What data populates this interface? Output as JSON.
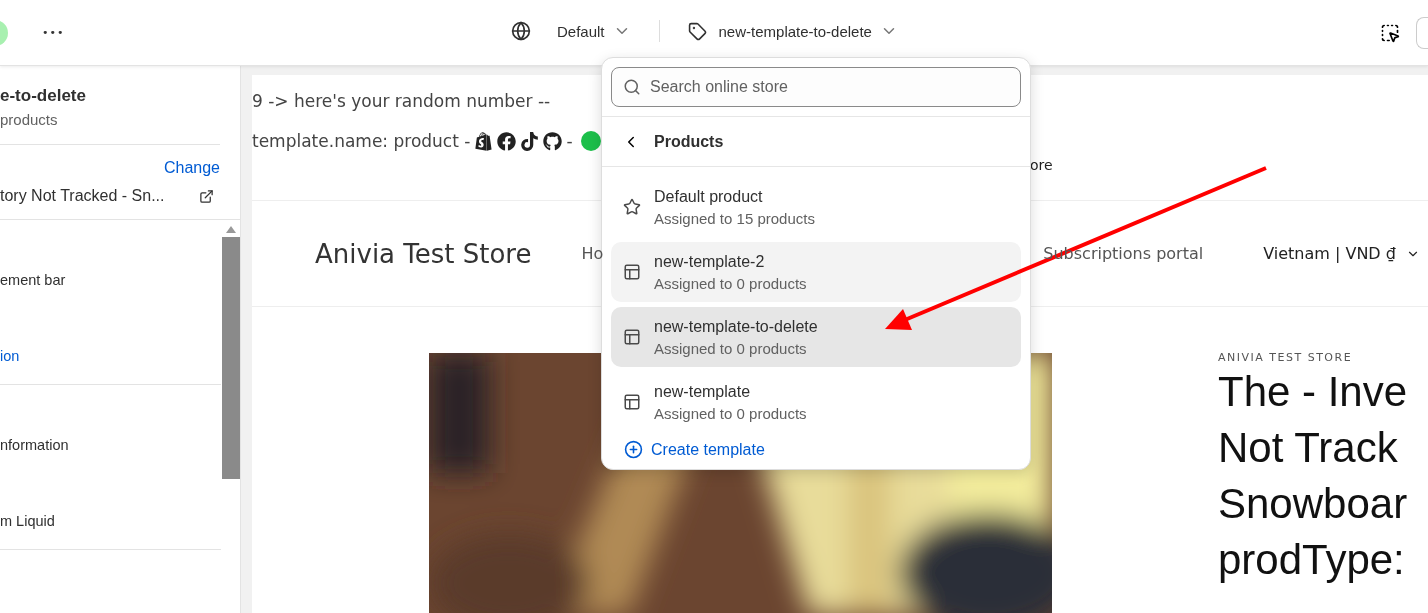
{
  "topbar": {
    "more": "•••",
    "theme": "Default",
    "template": "new-template-to-delete"
  },
  "sidebar": {
    "title": "e-to-delete",
    "subtitle": "products",
    "change_link": "Change",
    "product": "tory Not Tracked - Sn...",
    "sections": [
      {
        "items": [
          {
            "kind": "label",
            "text": "ement bar"
          },
          {
            "kind": "link",
            "text": "ion"
          }
        ]
      },
      {
        "items": [
          {
            "kind": "label",
            "text": "nformation"
          },
          {
            "kind": "label",
            "text": "m Liquid"
          }
        ]
      }
    ]
  },
  "preview": {
    "line_1": "9 -> here's your random number --",
    "line_2": "template.name: product -",
    "line_2_end": "-",
    "announcement": "ore",
    "store_name": "Anivia Test Store",
    "nav": [
      "Ho",
      "Subscriptions portal"
    ],
    "locale": "Vietnam | VND ₫",
    "vendor": "ANIVIA TEST STORE",
    "title_lines": [
      "The - Inve",
      "Not Track",
      "Snowboar",
      "prodType:"
    ]
  },
  "dropdown": {
    "search": {
      "placeholder": "Search online store"
    },
    "heading": "Products",
    "items": [
      {
        "kind": "default",
        "name": "Default product",
        "detail": "Assigned to 15 products",
        "selected": false,
        "hovered": false
      },
      {
        "kind": "template",
        "name": "new-template-2",
        "detail": "Assigned to 0 products",
        "selected": false,
        "hovered": true
      },
      {
        "kind": "template",
        "name": "new-template-to-delete",
        "detail": "Assigned to 0 products",
        "selected": true,
        "hovered": false
      },
      {
        "kind": "template",
        "name": "new-template",
        "detail": "Assigned to 0 products",
        "selected": false,
        "hovered": false
      }
    ],
    "create": "Create template"
  }
}
